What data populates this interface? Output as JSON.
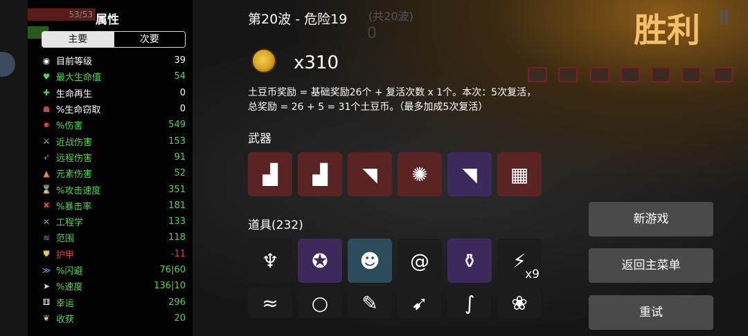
{
  "stats_panel": {
    "hp": "53/53",
    "title": "属性",
    "tabs": [
      "主要",
      "次要"
    ],
    "rows": [
      {
        "icon": "level-icon",
        "glyph": "◉",
        "label": "目前等级",
        "value": "39",
        "label_color": "#ffffff",
        "value_color": "#ffffff",
        "icon_color": "#ffffff"
      },
      {
        "icon": "heart-icon",
        "glyph": "♥",
        "label": "最大生命值",
        "value": "54",
        "label_color": "#4cd94c",
        "value_color": "#4cd94c",
        "icon_color": "#4cd94c"
      },
      {
        "icon": "regen-icon",
        "glyph": "✚",
        "label": "生命再生",
        "value": "0",
        "label_color": "#ffffff",
        "value_color": "#ffffff",
        "icon_color": "#4cd94c"
      },
      {
        "icon": "lifesteal-icon",
        "glyph": "☗",
        "label": "%生命窃取",
        "value": "0",
        "label_color": "#ffffff",
        "value_color": "#ffffff",
        "icon_color": "#d04050"
      },
      {
        "icon": "damage-icon",
        "glyph": "✸",
        "label": "%伤害",
        "value": "549",
        "label_color": "#4cd94c",
        "value_color": "#4cd94c",
        "icon_color": "#e04040"
      },
      {
        "icon": "melee-icon",
        "glyph": "⚔",
        "label": "近战伤害",
        "value": "153",
        "label_color": "#4cd94c",
        "value_color": "#4cd94c",
        "icon_color": "#e0c070"
      },
      {
        "icon": "ranged-icon",
        "glyph": "➶",
        "label": "远程伤害",
        "value": "91",
        "label_color": "#4cd94c",
        "value_color": "#4cd94c",
        "icon_color": "#d060d0"
      },
      {
        "icon": "elemental-icon",
        "glyph": "▲",
        "label": "元素伤害",
        "value": "52",
        "label_color": "#4cd94c",
        "value_color": "#4cd94c",
        "icon_color": "#f08040"
      },
      {
        "icon": "attack-speed-icon",
        "glyph": "⌛",
        "label": "%攻击速度",
        "value": "351",
        "label_color": "#4cd94c",
        "value_color": "#4cd94c",
        "icon_color": "#dddddd"
      },
      {
        "icon": "crit-icon",
        "glyph": "✖",
        "label": "%暴击率",
        "value": "181",
        "label_color": "#4cd94c",
        "value_color": "#4cd94c",
        "icon_color": "#e04040"
      },
      {
        "icon": "engineering-icon",
        "glyph": "✕",
        "label": "工程学",
        "value": "133",
        "label_color": "#4cd94c",
        "value_color": "#4cd94c",
        "icon_color": "#60b0e0"
      },
      {
        "icon": "range-icon",
        "glyph": "≋",
        "label": "范围",
        "value": "118",
        "label_color": "#4cd94c",
        "value_color": "#4cd94c",
        "icon_color": "#b060e0"
      },
      {
        "icon": "armor-icon",
        "glyph": "⛊",
        "label": "护甲",
        "value": "-11",
        "label_color": "#e04040",
        "value_color": "#e04040",
        "icon_color": "#e0d040"
      },
      {
        "icon": "dodge-icon",
        "glyph": "≫",
        "label": "%闪避",
        "value": "76|60",
        "label_color": "#4cd94c",
        "value_color": "#4cd94c",
        "icon_color": "#60c0e0"
      },
      {
        "icon": "speed-icon",
        "glyph": "➤",
        "label": "%速度",
        "value": "136|10",
        "label_color": "#4cd94c",
        "value_color": "#4cd94c",
        "icon_color": "#dddddd"
      },
      {
        "icon": "luck-icon",
        "glyph": "⚅",
        "label": "幸运",
        "value": "296",
        "label_color": "#4cd94c",
        "value_color": "#4cd94c",
        "icon_color": "#ffffff"
      },
      {
        "icon": "harvest-icon",
        "glyph": "❦",
        "label": "收获",
        "value": "20",
        "label_color": "#4cd94c",
        "value_color": "#4cd94c",
        "icon_color": "#e0d070"
      }
    ]
  },
  "header": {
    "wave_title": "第20波 - 危险19",
    "wave_total": "(共20波)",
    "wave_zero": "0",
    "victory": "胜利"
  },
  "reward": {
    "coin_count": "x310",
    "line1": "土豆币奖励 = 基础奖励26个 + 复活次数 x 1个。本次：5次复活，",
    "line2": "总奖励 = 26 + 5 = 31个土豆币。（最多加成5次复活）"
  },
  "sections": {
    "weapons": "武器",
    "items": "道具(232)"
  },
  "weapons": [
    {
      "name": "weapon-gun-icon",
      "glyph": "▟",
      "tier": "red"
    },
    {
      "name": "weapon-gun-icon",
      "glyph": "▟",
      "tier": "red"
    },
    {
      "name": "weapon-laser-icon",
      "glyph": "◥",
      "tier": "red"
    },
    {
      "name": "weapon-creature-icon",
      "glyph": "✺",
      "tier": "red"
    },
    {
      "name": "weapon-laser-icon",
      "glyph": "◥",
      "tier": "purple"
    },
    {
      "name": "weapon-minigun-icon",
      "glyph": "▦",
      "tier": "red"
    }
  ],
  "items": [
    {
      "name": "item-altar-icon",
      "glyph": "♆",
      "tier": "dark",
      "count": ""
    },
    {
      "name": "item-shield-icon",
      "glyph": "✪",
      "tier": "purple",
      "count": ""
    },
    {
      "name": "item-clown-icon",
      "glyph": "☻",
      "tier": "blue",
      "count": ""
    },
    {
      "name": "item-snail-icon",
      "glyph": "@",
      "tier": "dark",
      "count": ""
    },
    {
      "name": "item-bottle-icon",
      "glyph": "⚱",
      "tier": "purple",
      "count": ""
    },
    {
      "name": "item-twig-icon",
      "glyph": "⚡",
      "tier": "dark",
      "count": "x9"
    },
    {
      "name": "item-lizard-icon",
      "glyph": "≈",
      "tier": "dark",
      "count": ""
    },
    {
      "name": "item-bubble-icon",
      "glyph": "○",
      "tier": "dark",
      "count": ""
    },
    {
      "name": "item-syringe-icon",
      "glyph": "✎",
      "tier": "dark",
      "count": ""
    },
    {
      "name": "item-rocket-icon",
      "glyph": "➹",
      "tier": "dark",
      "count": ""
    },
    {
      "name": "item-snake-icon",
      "glyph": "∫",
      "tier": "dark",
      "count": ""
    },
    {
      "name": "item-potato-icon",
      "glyph": "❀",
      "tier": "dark",
      "count": ""
    }
  ],
  "buttons": {
    "new_game": "新游戏",
    "main_menu": "返回主菜单",
    "retry": "重试"
  },
  "colors": {
    "victory": "#f4c06a",
    "stat_green": "#4cd94c",
    "stat_red": "#e04040",
    "tier_red": "#5a2424",
    "tier_purple": "#3d2a5c",
    "tier_blue": "#2c4c5c"
  }
}
